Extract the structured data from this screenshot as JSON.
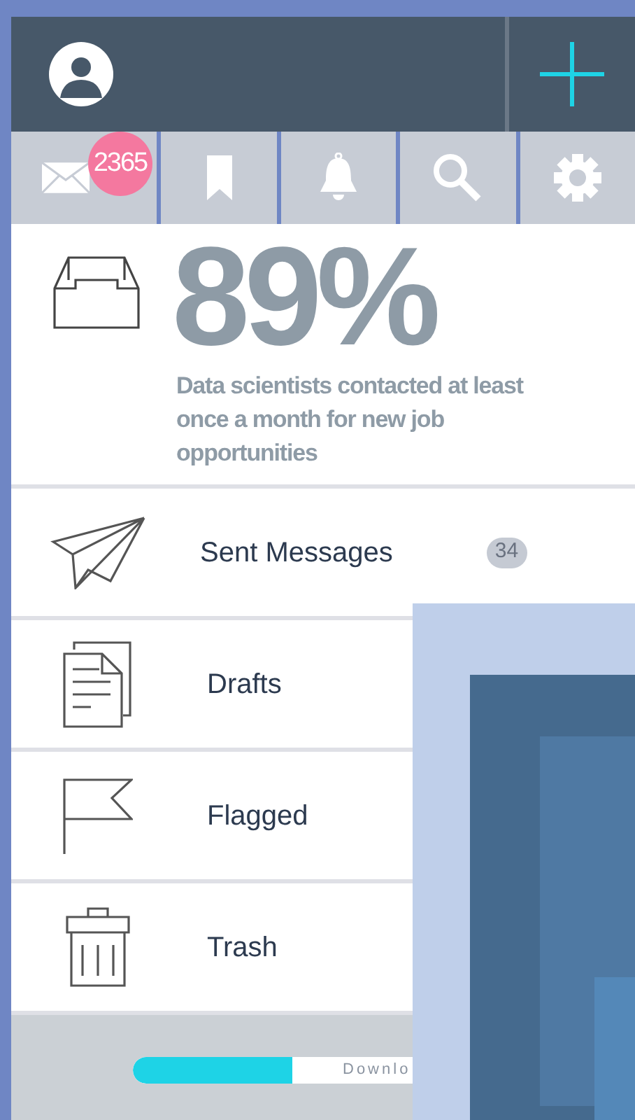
{
  "toolbar": [
    {
      "kind": "mail",
      "badge": "2365"
    },
    {
      "kind": "bookmark"
    },
    {
      "kind": "bell"
    },
    {
      "kind": "search"
    },
    {
      "kind": "gear"
    }
  ],
  "stat": {
    "value": "89%",
    "caption": "Data scientists contacted at least once a month for new job opportunities"
  },
  "folders": [
    {
      "kind": "sent",
      "label": "Sent Messages",
      "count": "34"
    },
    {
      "kind": "drafts",
      "label": "Drafts"
    },
    {
      "kind": "flag",
      "label": "Flagged"
    },
    {
      "kind": "trash",
      "label": "Trash"
    }
  ],
  "download": {
    "label": "Downlo",
    "level": 0.57
  }
}
